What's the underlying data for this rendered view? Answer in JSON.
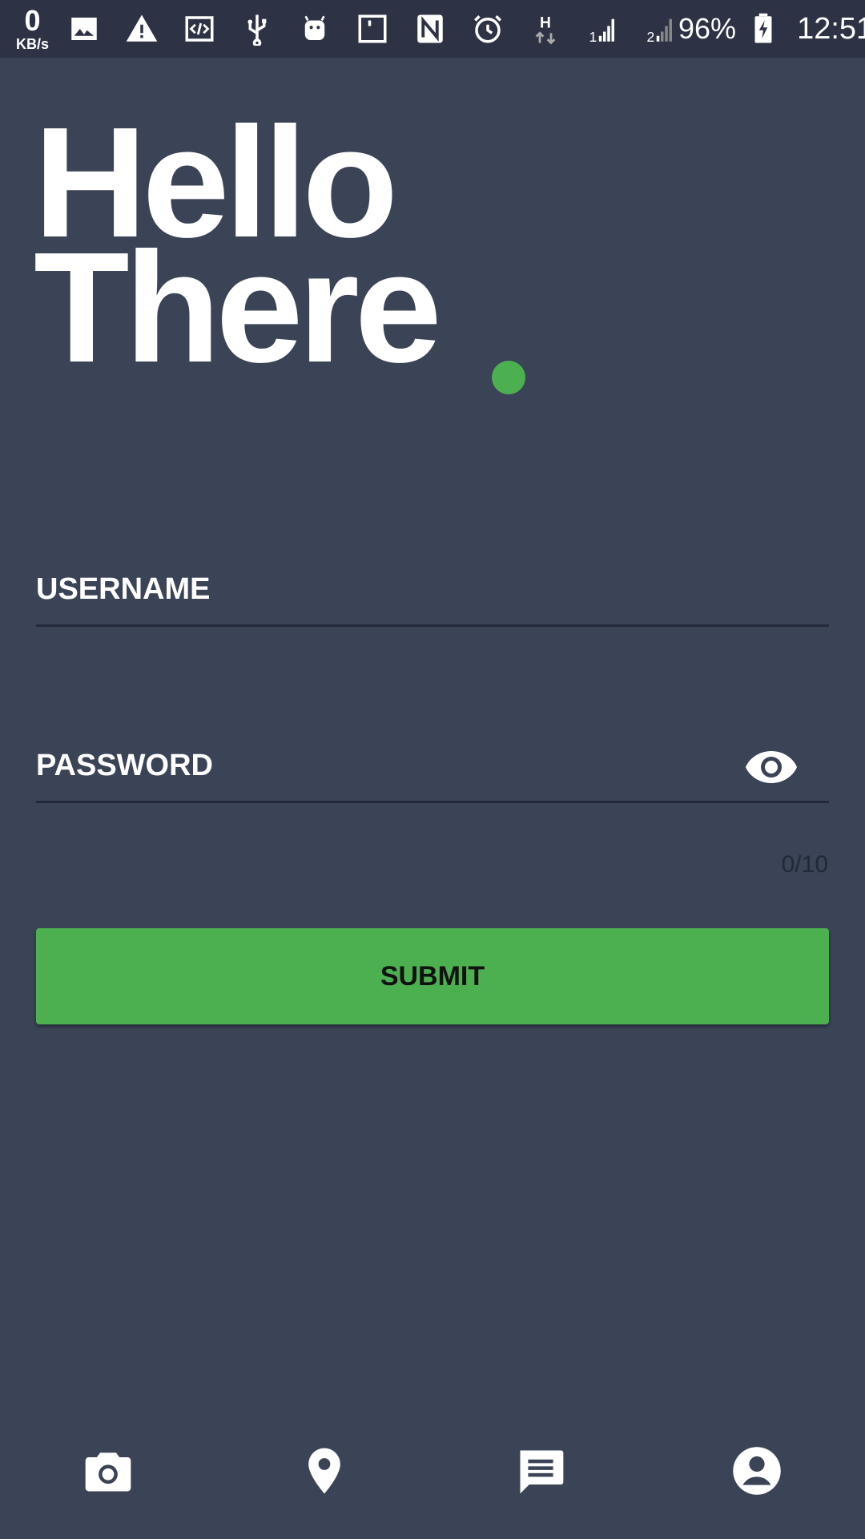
{
  "status_bar": {
    "net_speed": "0",
    "net_speed_unit": "KB/s",
    "icons": [
      "image-icon",
      "warning-icon",
      "code-icon",
      "usb-icon",
      "android-icon",
      "sim-icon",
      "nfc-icon",
      "alarm-icon",
      "h-data-icon",
      "signal-1-icon",
      "signal-2-icon",
      "battery-charging-icon"
    ],
    "battery": "96%",
    "time": "12:51",
    "sim1_label": "1",
    "sim2_label": "2",
    "data_label": "H"
  },
  "hero": {
    "line1": "Hello",
    "line2": "There"
  },
  "form": {
    "username_placeholder": "USERNAME",
    "password_placeholder": "PASSWORD",
    "password_counter": "0/10",
    "submit_label": "SUBMIT"
  },
  "bottom_nav": {
    "items": [
      "camera-icon",
      "location-icon",
      "message-icon",
      "account-icon"
    ]
  },
  "colors": {
    "background": "#3b4356",
    "status_bar": "#2d3344",
    "accent": "#4caf50",
    "text": "#ffffff",
    "underline": "#23283a"
  }
}
